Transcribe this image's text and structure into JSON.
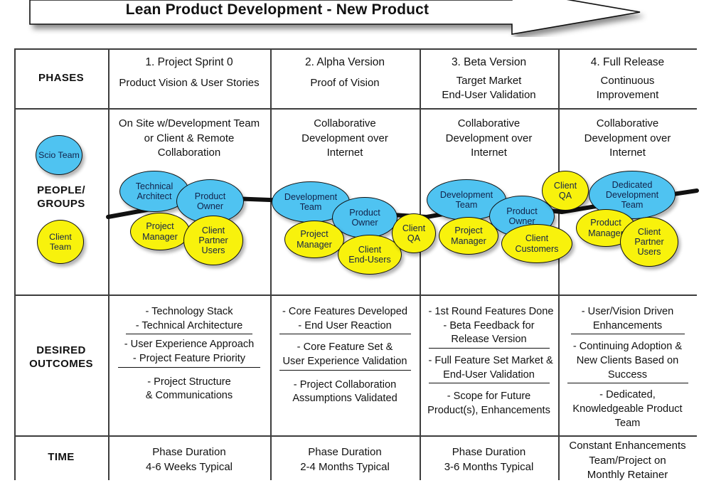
{
  "title": "Lean Product Development - New Product",
  "rows": {
    "phases_label": "PHASES",
    "people_label": "PEOPLE/\nGROUPS",
    "people_label_line1": "PEOPLE/",
    "people_label_line2": "GROUPS",
    "outcomes_label_line1": "DESIRED",
    "outcomes_label_line2": "OUTCOMES",
    "time_label": "TIME"
  },
  "legend": [
    {
      "name": "scio-team",
      "line1": "Scio",
      "line2": "Team",
      "color": "#4FC3F1"
    },
    {
      "name": "client-team",
      "line1": "Client",
      "line2": "Team",
      "color": "#F8F20C"
    }
  ],
  "columns": [
    {
      "phase_number": "1.   Project Sprint 0",
      "phase_sub": [
        "Product Vision & User Stories"
      ],
      "people_heading": [
        "On Site w/Development Team",
        "or Client & Remote",
        "Collaboration"
      ],
      "bubbles": [
        {
          "label": [
            "Technical",
            "Architect"
          ],
          "color": "blue"
        },
        {
          "label": [
            "Product",
            "Owner"
          ],
          "color": "blue"
        },
        {
          "label": [
            "Project",
            "Manager"
          ],
          "color": "yellow"
        },
        {
          "label": [
            "Client",
            "Partner",
            "Users"
          ],
          "color": "yellow"
        }
      ],
      "outcomes": [
        {
          "lines": [
            "- Technology Stack",
            "- Technical Architecture"
          ],
          "underline": true
        },
        {
          "lines": [
            "- User Experience Approach",
            "- Project Feature Priority"
          ],
          "underline": true
        },
        {
          "lines": [
            "- Project Structure",
            "& Communications"
          ],
          "underline": false
        }
      ],
      "time": [
        "Phase Duration",
        "4-6 Weeks Typical"
      ]
    },
    {
      "phase_number": "2. Alpha Version",
      "phase_sub": [
        "Proof of Vision"
      ],
      "people_heading": [
        "Collaborative",
        "Development over",
        "Internet"
      ],
      "bubbles": [
        {
          "label": [
            "Development",
            "Team"
          ],
          "color": "blue"
        },
        {
          "label": [
            "Product",
            "Owner"
          ],
          "color": "blue"
        },
        {
          "label": [
            "Project",
            "Manager"
          ],
          "color": "yellow"
        },
        {
          "label": [
            "Client",
            "End-Users"
          ],
          "color": "yellow"
        },
        {
          "label": [
            "Client",
            "QA"
          ],
          "color": "yellow"
        }
      ],
      "outcomes": [
        {
          "lines": [
            "- Core Features Developed",
            "- End User Reaction"
          ],
          "underline": true
        },
        {
          "lines": [
            "- Core Feature Set &",
            "User Experience Validation"
          ],
          "underline": true
        },
        {
          "lines": [
            "- Project Collaboration",
            "Assumptions Validated"
          ],
          "underline": false
        }
      ],
      "time": [
        "Phase Duration",
        "2-4 Months Typical"
      ]
    },
    {
      "phase_number": "3.  Beta Version",
      "phase_sub": [
        "Target Market",
        "End-User Validation"
      ],
      "people_heading": [
        "Collaborative",
        "Development over",
        "Internet"
      ],
      "bubbles": [
        {
          "label": [
            "Development",
            "Team"
          ],
          "color": "blue"
        },
        {
          "label": [
            "Product",
            "Owner"
          ],
          "color": "blue"
        },
        {
          "label": [
            "Project",
            "Manager"
          ],
          "color": "yellow"
        },
        {
          "label": [
            "Client",
            "Customers"
          ],
          "color": "yellow"
        },
        {
          "label": [
            "Client",
            "QA"
          ],
          "color": "yellow"
        }
      ],
      "outcomes": [
        {
          "lines": [
            "- 1st Round Features Done",
            "- Beta Feedback for",
            "Release Version"
          ],
          "underline": true
        },
        {
          "lines": [
            "- Full Feature Set Market &",
            "End-User Validation"
          ],
          "underline": true
        },
        {
          "lines": [
            "- Scope for Future",
            "Product(s), Enhancements"
          ],
          "underline": false
        }
      ],
      "time": [
        "Phase Duration",
        "3-6 Months Typical"
      ]
    },
    {
      "phase_number": "4. Full Release",
      "phase_sub": [
        "Continuous",
        "Improvement"
      ],
      "people_heading": [
        "Collaborative",
        "Development over",
        "Internet"
      ],
      "bubbles": [
        {
          "label": [
            "Dedicated",
            "Development",
            "Team"
          ],
          "color": "blue"
        },
        {
          "label": [
            "Product",
            "Manager"
          ],
          "color": "yellow"
        },
        {
          "label": [
            "Client",
            "Partner",
            "Users"
          ],
          "color": "yellow"
        }
      ],
      "outcomes": [
        {
          "lines": [
            "- User/Vision Driven",
            "Enhancements"
          ],
          "underline": true
        },
        {
          "lines": [
            "- Continuing Adoption &",
            "New Clients Based on",
            "Success"
          ],
          "underline": true
        },
        {
          "lines": [
            "- Dedicated,",
            "Knowledgeable Product",
            "Team"
          ],
          "underline": true
        }
      ],
      "time": [
        "Constant Enhancements",
        "Team/Project on",
        "Monthly Retainer"
      ]
    }
  ],
  "colors": {
    "scio_blue": "#4FC3F1",
    "client_yellow": "#F8F20C",
    "line": "#3d3d3d",
    "text": "#111111"
  }
}
